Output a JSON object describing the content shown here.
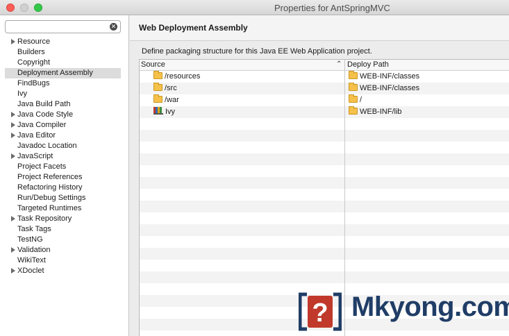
{
  "window": {
    "title": "Properties for AntSpringMVC"
  },
  "filter": {
    "value": "",
    "placeholder": ""
  },
  "tree": [
    {
      "label": "Resource",
      "expandable": true
    },
    {
      "label": "Builders",
      "expandable": false
    },
    {
      "label": "Copyright",
      "expandable": false
    },
    {
      "label": "Deployment Assembly",
      "expandable": false,
      "selected": true
    },
    {
      "label": "FindBugs",
      "expandable": false
    },
    {
      "label": "Ivy",
      "expandable": false
    },
    {
      "label": "Java Build Path",
      "expandable": false
    },
    {
      "label": "Java Code Style",
      "expandable": true
    },
    {
      "label": "Java Compiler",
      "expandable": true
    },
    {
      "label": "Java Editor",
      "expandable": true
    },
    {
      "label": "Javadoc Location",
      "expandable": false
    },
    {
      "label": "JavaScript",
      "expandable": true
    },
    {
      "label": "Project Facets",
      "expandable": false
    },
    {
      "label": "Project References",
      "expandable": false
    },
    {
      "label": "Refactoring History",
      "expandable": false
    },
    {
      "label": "Run/Debug Settings",
      "expandable": false
    },
    {
      "label": "Targeted Runtimes",
      "expandable": false
    },
    {
      "label": "Task Repository",
      "expandable": true
    },
    {
      "label": "Task Tags",
      "expandable": false
    },
    {
      "label": "TestNG",
      "expandable": false
    },
    {
      "label": "Validation",
      "expandable": true
    },
    {
      "label": "WikiText",
      "expandable": false
    },
    {
      "label": "XDoclet",
      "expandable": true
    }
  ],
  "page": {
    "title": "Web Deployment Assembly",
    "description": "Define packaging structure for this Java EE Web Application project."
  },
  "table": {
    "columns": [
      "Source",
      "Deploy Path"
    ],
    "sort_icon": "chevron-up-icon",
    "rows": [
      {
        "source": "/resources",
        "source_icon": "folder-icon",
        "deploy": "WEB-INF/classes"
      },
      {
        "source": "/src",
        "source_icon": "folder-icon",
        "deploy": "WEB-INF/classes"
      },
      {
        "source": "/war",
        "source_icon": "folder-icon",
        "deploy": "/"
      },
      {
        "source": "Ivy",
        "source_icon": "library-icon",
        "deploy": "WEB-INF/lib"
      }
    ],
    "empty_rows": 18
  },
  "watermark": {
    "text": "Mkyong.com",
    "mark_glyph": "?"
  },
  "colors": {
    "selection": "#dcdcdc",
    "folder": "#f6c14b",
    "logo_blue": "#1f3d66",
    "logo_red": "#c0392b"
  }
}
